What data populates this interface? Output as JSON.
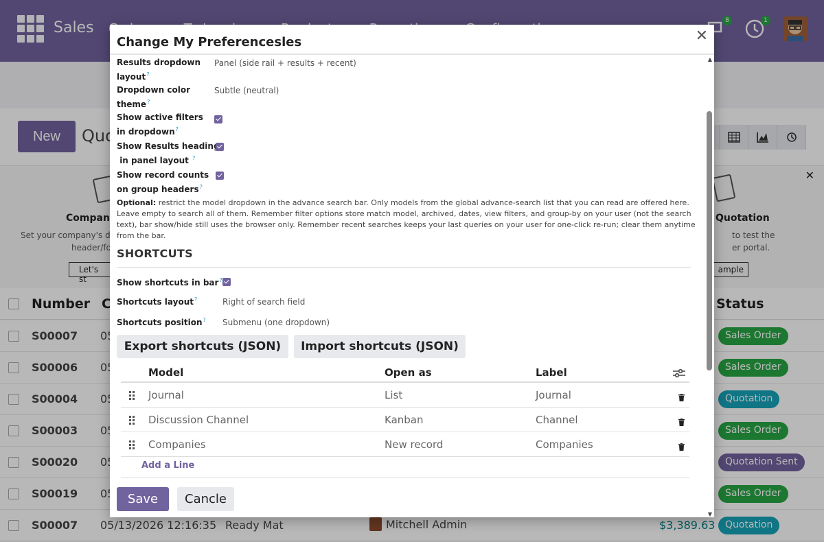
{
  "app": {
    "name": "Sales",
    "nav_items": [
      "Orders",
      "To Invoice",
      "Products",
      "Reporting",
      "Configuration"
    ],
    "chat_badge": "8",
    "activity_badge": "1"
  },
  "control": {
    "new_label": "New",
    "title": "Quotations"
  },
  "banner": {
    "left_title": "Company",
    "left_desc_1": "Set your company's da",
    "left_desc_2": "header/fo",
    "left_button": "Let's st",
    "right_title": "Quotation",
    "right_desc_1": "to test the",
    "right_desc_2": "er portal.",
    "right_button": "ample"
  },
  "list": {
    "headers": [
      "Number",
      "C",
      "Status"
    ],
    "rows": [
      {
        "number": "S00007",
        "date": "05",
        "status": "Sales Order",
        "color": "#28a745"
      },
      {
        "number": "S00006",
        "date": "05",
        "status": "Sales Order",
        "color": "#28a745"
      },
      {
        "number": "S00004",
        "date": "05",
        "status": "Quotation",
        "color": "#17a2b8"
      },
      {
        "number": "S00003",
        "date": "05",
        "status": "Sales Order",
        "color": "#28a745"
      },
      {
        "number": "S00020",
        "date": "05",
        "status": "Quotation Sent",
        "color": "#71639e"
      },
      {
        "number": "S00019",
        "date": "05",
        "status": "Sales Order",
        "color": "#28a745"
      },
      {
        "number": "S00007",
        "date": "05/13/2026 12:16:35",
        "customer": "Ready Mat",
        "salesperson": "Mitchell Admin",
        "amount": "$3,389.63",
        "status": "Quotation",
        "color": "#17a2b8"
      }
    ]
  },
  "modal": {
    "title": "Change My Preferencesles",
    "fields": {
      "results_layout_label_1": "Results dropdown",
      "results_layout_label_2": "layout",
      "results_layout_value": "Panel (side rail + results + recent)",
      "color_theme_label_1": "Dropdown color",
      "color_theme_label_2": "theme",
      "color_theme_value": "Subtle (neutral)",
      "active_filters_label_1": "Show active filters",
      "active_filters_label_2": "in dropdown",
      "results_heading_label_1": "Show Results heading",
      "results_heading_label_2": "in panel layout",
      "record_counts_label_1": "Show record counts",
      "record_counts_label_2": "on group headers",
      "help_mark": "?"
    },
    "help": {
      "bold": "Optional:",
      "line_1": " restrict the model dropdown in the advance search bar. Only models from the global advance-search list that you can read are offered here.",
      "line_2": "Leave empty to search all of them. Remember filter options store match model, archived, dates, view filters, and group-by on your user (not the search",
      "line_3": "text), bar show/hide still uses the browser only. Remember recent searches keeps your last queries on your user for one-click re-run; clear them anytime",
      "line_4": "from the bar."
    },
    "shortcuts": {
      "section_title": "SHORTCUTS",
      "show_in_bar_label": "Show shortcuts in bar",
      "layout_label": "Shortcuts layout",
      "layout_value": "Right of search field",
      "position_label": "Shortcuts position",
      "position_value": "Submenu (one dropdown)",
      "export_label": "Export shortcuts (JSON)",
      "import_label": "Import shortcuts (JSON)",
      "columns": {
        "model": "Model",
        "open_as": "Open as",
        "label": "Label"
      },
      "rows": [
        {
          "model": "Journal",
          "open_as": "List",
          "label": "Journal"
        },
        {
          "model": "Discussion Channel",
          "open_as": "Kanban",
          "label": "Channel"
        },
        {
          "model": "Companies",
          "open_as": "New record",
          "label": "Companies"
        }
      ],
      "add_line": "Add a Line"
    },
    "footer": {
      "save": "Save",
      "cancel": "Cancle"
    }
  }
}
